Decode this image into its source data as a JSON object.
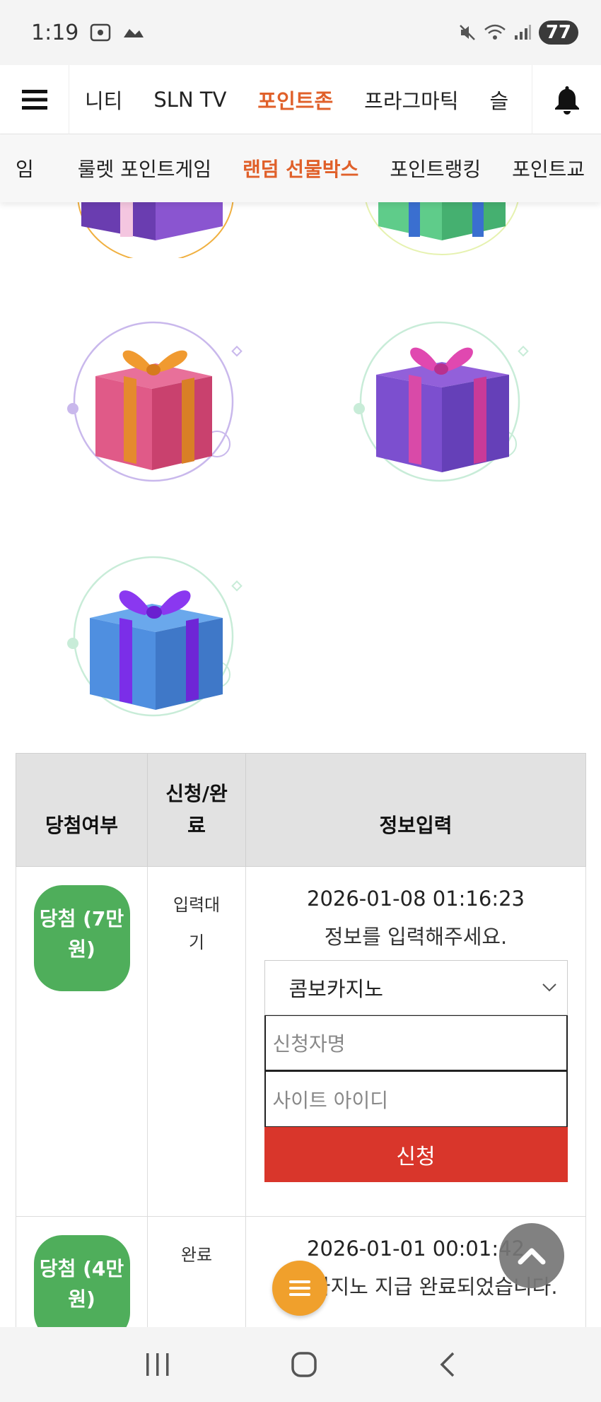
{
  "status_bar": {
    "time": "1:19",
    "battery": "77"
  },
  "top_nav": {
    "tabs": [
      "니티",
      "SLN TV",
      "포인트존",
      "프라그마틱",
      "슬"
    ],
    "active_tab": "포인트존"
  },
  "sub_nav": {
    "tabs": [
      "임",
      "룰렛 포인트게임",
      "랜덤 선물박스",
      "포인트랭킹",
      "포인트교"
    ],
    "active_tab": "랜덤 선물박스"
  },
  "table": {
    "headers": {
      "result": "당첨여부",
      "apply": "신청/완료",
      "info": "정보입력"
    },
    "rows": [
      {
        "badge": "당첨 (7만원)",
        "status": "입력대기",
        "date": "2026-01-08 01:16:23",
        "message": "정보를 입력해주세요.",
        "select_value": "콤보카지노",
        "name_placeholder": "신청자명",
        "id_placeholder": "사이트 아이디",
        "submit_label": "신청"
      },
      {
        "badge": "당첨 (4만원)",
        "status": "완료",
        "date": "2026-01-01 00:01:42",
        "message": "콤보카지노 지급 완료되었습니다."
      }
    ]
  },
  "colors": {
    "accent_orange": "#e0602a",
    "win_green": "#4fae5b",
    "submit_red": "#d9362b",
    "fab_orange": "#f0a02c"
  }
}
